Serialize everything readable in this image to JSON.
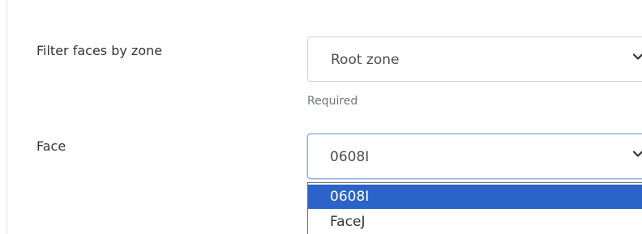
{
  "form": {
    "zone_field": {
      "label": "Filter faces by zone",
      "selected": "Root zone",
      "help_text": "Required"
    },
    "face_field": {
      "label": "Face",
      "selected": "0608I",
      "options": [
        "0608I",
        "FaceJ"
      ],
      "highlighted_option": "0608I"
    }
  },
  "icons": {
    "select_arrow": "chevron-down-icon"
  },
  "colors": {
    "highlight": "#2b63c9",
    "focus_border": "#8fb3e0",
    "label_text": "#333333",
    "help_text": "#6c757d"
  }
}
